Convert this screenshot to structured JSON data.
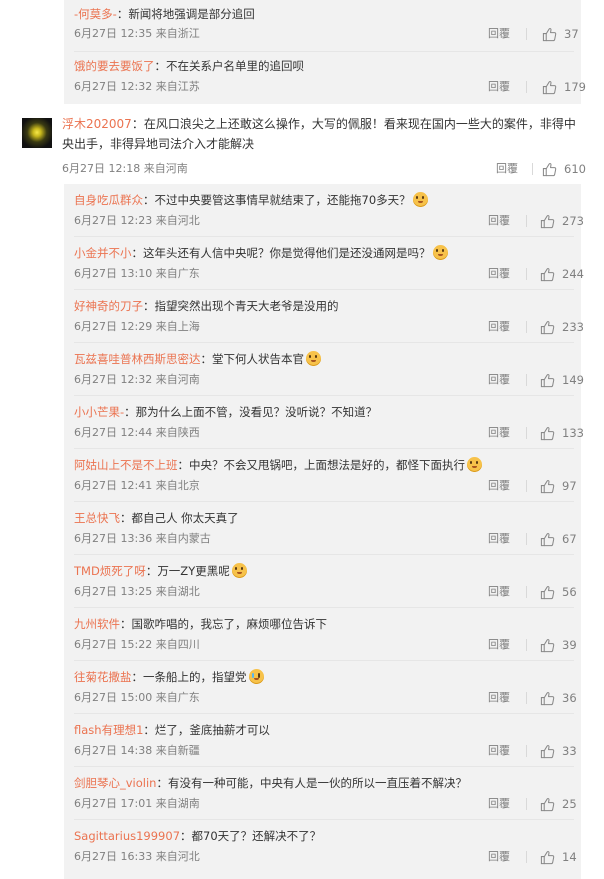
{
  "top_replies": [
    {
      "author": "-何莫多-",
      "text": "新闻将地强调是部分追回",
      "time": "6月27日 12:35 来自浙江",
      "reply": "回覆",
      "likes": "37"
    },
    {
      "author": "饿的要去要饭了",
      "text": "不在关系户名单里的追回呗",
      "time": "6月27日 12:32 来自江苏",
      "reply": "回覆",
      "likes": "179"
    }
  ],
  "main_comment": {
    "author": "浮木202007",
    "text_line1": "在风口浪尖之上还敢这么操作，大写的佩服！看来现在国内一些大的案件，非得中",
    "text_line2": "央出手，非得异地司法介入才能解决",
    "time": "6月27日 12:18 来自河南",
    "reply": "回覆",
    "likes": "610"
  },
  "replies": [
    {
      "author": "自身吃瓜群众",
      "text": "不过中央要管这事情早就结束了，还能拖70多天？",
      "emoji": "smile",
      "time": "6月27日 12:23 来自河北",
      "reply": "回覆",
      "likes": "273"
    },
    {
      "author": "小金并不小",
      "text": "这年头还有人信中央呢？你是觉得他们是还没通网是吗？",
      "emoji": "smile",
      "time": "6月27日 13:10 来自广东",
      "reply": "回覆",
      "likes": "244"
    },
    {
      "author": "好神奇的刀子",
      "text": "指望突然出现个青天大老爷是没用的",
      "emoji": "",
      "time": "6月27日 12:29 来自上海",
      "reply": "回覆",
      "likes": "233"
    },
    {
      "author": "瓦兹喜哇普林西斯思密达",
      "text": "堂下何人状告本官",
      "emoji": "smile",
      "time": "6月27日 12:32 来自河南",
      "reply": "回覆",
      "likes": "149"
    },
    {
      "author": "小小芒果-",
      "text": "那为什么上面不管，没看见？没听说？不知道？",
      "emoji": "",
      "time": "6月27日 12:44 来自陕西",
      "reply": "回覆",
      "likes": "133"
    },
    {
      "author": "阿姑山上不是不上班",
      "text": "中央？不会又甩锅吧，上面想法是好的，都怪下面执行",
      "emoji": "smile",
      "time": "6月27日 12:41 来自北京",
      "reply": "回覆",
      "likes": "97"
    },
    {
      "author": "王总快飞",
      "text": "都自己人 你太天真了",
      "emoji": "",
      "time": "6月27日 13:36 来自内蒙古",
      "reply": "回覆",
      "likes": "67"
    },
    {
      "author": "TMD烦死了呀",
      "text": "万一ZY更黑呢",
      "emoji": "smile",
      "time": "6月27日 13:25 来自湖北",
      "reply": "回覆",
      "likes": "56"
    },
    {
      "author": "九州软件",
      "text": "国歌咋唱的，我忘了，麻烦哪位告诉下",
      "emoji": "",
      "time": "6月27日 15:22 来自四川",
      "reply": "回覆",
      "likes": "39"
    },
    {
      "author": "往菊花撒盐",
      "text": "一条船上的，指望党",
      "emoji": "cry",
      "time": "6月27日 15:00 来自广东",
      "reply": "回覆",
      "likes": "36"
    },
    {
      "author": "flash有理想1",
      "text": "烂了，釜底抽薪才可以",
      "emoji": "",
      "time": "6月27日 14:38 来自新疆",
      "reply": "回覆",
      "likes": "33"
    },
    {
      "author": "剑胆琴心_violin",
      "text": "有没有一种可能，中央有人是一伙的所以一直压着不解决？",
      "emoji": "",
      "time": "6月27日 17:01 来自湖南",
      "reply": "回覆",
      "likes": "25"
    },
    {
      "author": "Sagittarius199907",
      "text": "都70天了？还解决不了？",
      "emoji": "",
      "time": "6月27日 16:33 来自河北",
      "reply": "回覆",
      "likes": "14"
    }
  ],
  "icons": {
    "like": "thumbs-up-icon",
    "avatar": "avatar-image"
  },
  "colors": {
    "author": "#eb7350",
    "meta": "#808080",
    "reply_bg": "#f2f2f2",
    "text": "#333333"
  }
}
